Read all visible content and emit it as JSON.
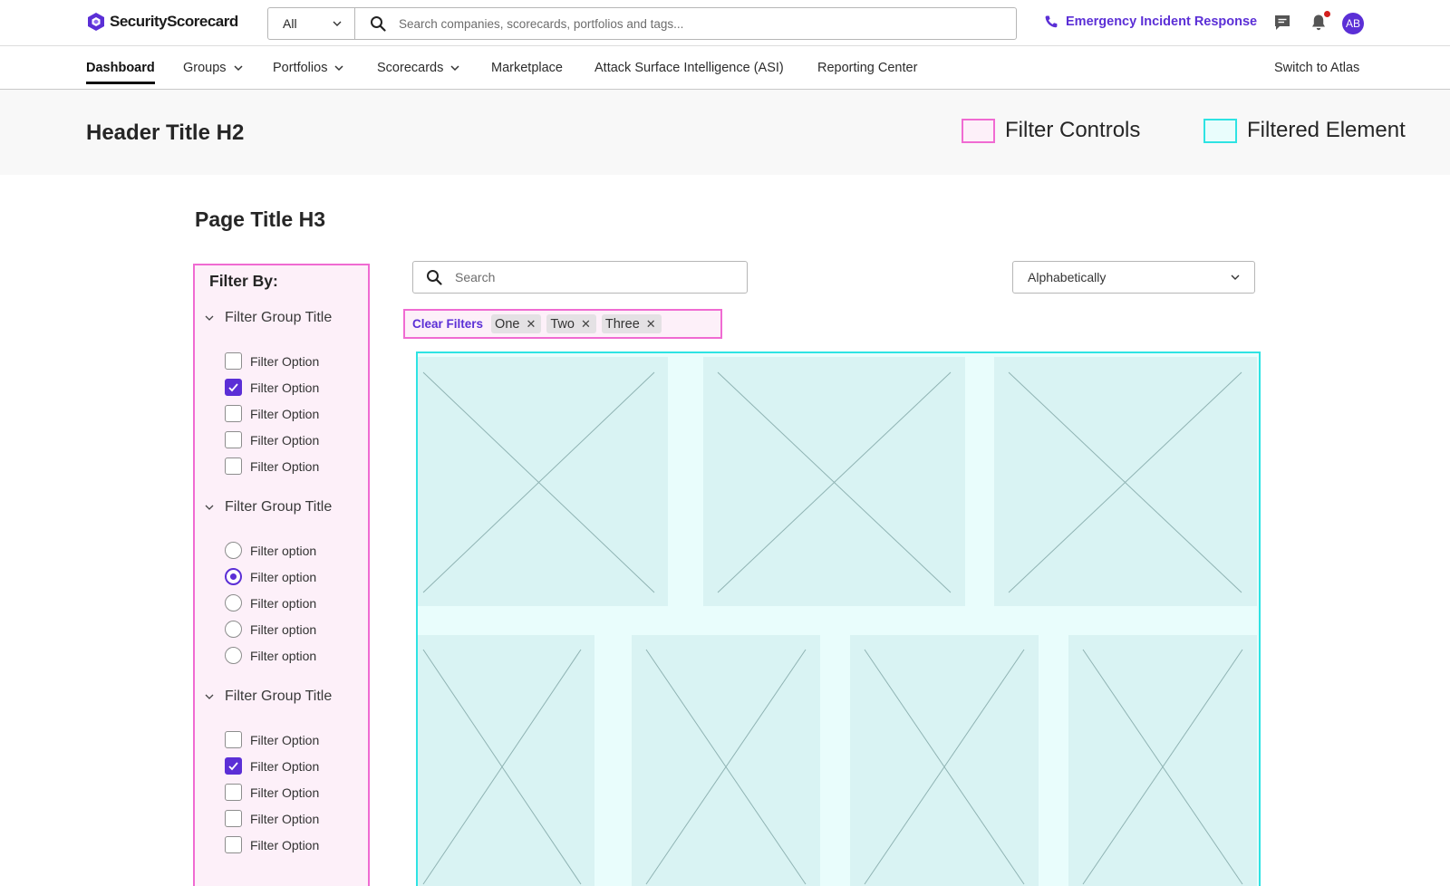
{
  "brand": {
    "name": "SecurityScorecard",
    "accent": "#5b2fd6"
  },
  "topbar": {
    "scope_value": "All",
    "search_placeholder": "Search companies, scorecards, portfolios and tags...",
    "emergency_label": "Emergency Incident Response",
    "avatar_initials": "AB",
    "icons": [
      "phone-icon",
      "chat-icon",
      "bell-icon"
    ]
  },
  "nav": {
    "items": [
      {
        "label": "Dashboard",
        "active": true
      },
      {
        "label": "Groups",
        "dropdown": true
      },
      {
        "label": "Portfolios",
        "dropdown": true
      },
      {
        "label": "Scorecards",
        "dropdown": true
      },
      {
        "label": "Marketplace"
      },
      {
        "label": "Attack Surface Intelligence (ASI)"
      },
      {
        "label": "Reporting Center"
      }
    ],
    "switch_label": "Switch to Atlas"
  },
  "header": {
    "title": "Header Title H2",
    "legend": [
      {
        "label": "Filter Controls",
        "color": "#f06bd2",
        "fill": "#fdf0f9"
      },
      {
        "label": "Filtered Element",
        "color": "#2ee3e3",
        "fill": "#e9fdfc"
      }
    ]
  },
  "page": {
    "title": "Page Title H3"
  },
  "filters": {
    "heading": "Filter By:",
    "groups": [
      {
        "title": "Filter Group Title",
        "type": "checkbox",
        "options": [
          {
            "label": "Filter Option",
            "checked": false
          },
          {
            "label": "Filter Option",
            "checked": true
          },
          {
            "label": "Filter Option",
            "checked": false
          },
          {
            "label": "Filter Option",
            "checked": false
          },
          {
            "label": "Filter Option",
            "checked": false
          }
        ]
      },
      {
        "title": "Filter Group Title",
        "type": "radio",
        "options": [
          {
            "label": "Filter option",
            "checked": false
          },
          {
            "label": "Filter option",
            "checked": true
          },
          {
            "label": "Filter option",
            "checked": false
          },
          {
            "label": "Filter option",
            "checked": false
          },
          {
            "label": "Filter option",
            "checked": false
          }
        ]
      },
      {
        "title": "Filter Group Title",
        "type": "checkbox",
        "options": [
          {
            "label": "Filter Option",
            "checked": false
          },
          {
            "label": "Filter Option",
            "checked": true
          },
          {
            "label": "Filter Option",
            "checked": false
          },
          {
            "label": "Filter Option",
            "checked": false
          },
          {
            "label": "Filter Option",
            "checked": false
          }
        ]
      }
    ]
  },
  "content": {
    "search_placeholder": "Search",
    "sort_value": "Alphabetically",
    "clear_filters_label": "Clear Filters",
    "chips": [
      "One",
      "Two",
      "Three"
    ]
  }
}
